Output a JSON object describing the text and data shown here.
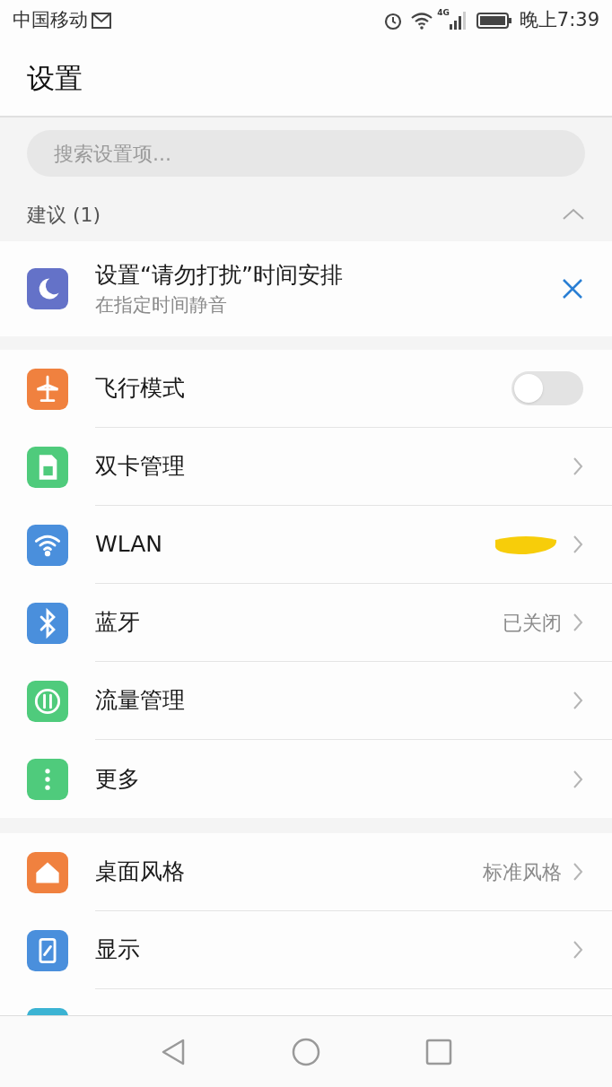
{
  "status_bar": {
    "carrier": "中国移动",
    "network": "4G",
    "time": "晚上7:39"
  },
  "title": "设置",
  "search": {
    "placeholder": "搜索设置项..."
  },
  "suggestions": {
    "header": "建议 (1)",
    "expanded": true,
    "items": [
      {
        "title": "设置“请勿打扰”时间安排",
        "subtitle": "在指定时间静音"
      }
    ]
  },
  "groups": [
    {
      "items": [
        {
          "kind": "toggle",
          "color": "#f0813f",
          "label": "飞行模式",
          "on": false
        },
        {
          "kind": "link",
          "color": "#4fcb7c",
          "label": "双卡管理"
        },
        {
          "kind": "link",
          "color": "#4a8fdc",
          "label": "WLAN",
          "redacted": true
        },
        {
          "kind": "link",
          "color": "#4a8fdc",
          "label": "蓝牙",
          "value": "已关闭"
        },
        {
          "kind": "link",
          "color": "#4fcb7c",
          "label": "流量管理"
        },
        {
          "kind": "link",
          "color": "#4fcb7c",
          "label": "更多"
        }
      ]
    },
    {
      "items": [
        {
          "kind": "link",
          "color": "#f0813f",
          "label": "桌面风格",
          "value": "标准风格"
        },
        {
          "kind": "link",
          "color": "#4a8fdc",
          "label": "显示"
        },
        {
          "kind": "partial",
          "color": "#3bb3d3"
        }
      ]
    }
  ]
}
